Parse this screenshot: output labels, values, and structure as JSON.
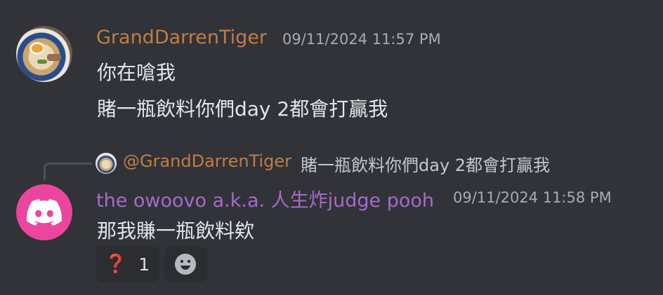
{
  "messages": [
    {
      "author": "GrandDarrenTiger",
      "author_color": "#c27c42",
      "timestamp": "09/11/2024 11:57 PM",
      "lines": [
        "你在嗆我",
        "賭一瓶飲料你們day 2都會打贏我"
      ]
    },
    {
      "reply": {
        "mention": "@GrandDarrenTiger",
        "quoted_text": "賭一瓶飲料你們day 2都會打贏我"
      },
      "author": "the owoovo a.k.a. 人生炸judge pooh",
      "author_color": "#a56bc9",
      "timestamp": "09/11/2024 11:58 PM",
      "lines": [
        "那我賺一瓶飲料欸"
      ],
      "reactions": [
        {
          "emoji": "❓",
          "count": "1"
        }
      ]
    }
  ],
  "colors": {
    "background": "#313338",
    "reaction_bg": "#2b2d31",
    "discord_pink": "#eb459e",
    "question_red": "#dd2e44"
  },
  "icons": {
    "add_reaction": "smiley-icon",
    "default_avatar": "discord-logo-icon"
  }
}
